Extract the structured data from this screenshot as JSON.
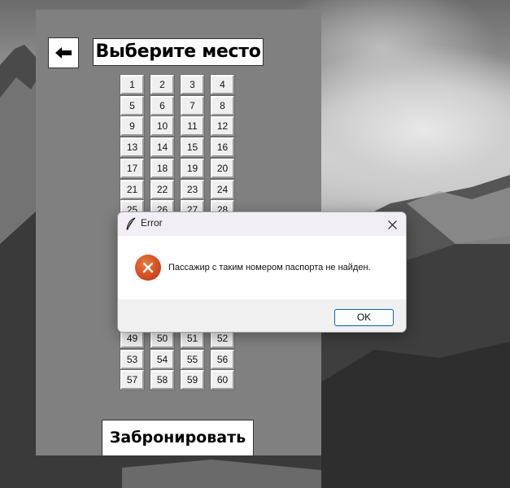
{
  "app": {
    "title": "Выберите место",
    "back_icon": "arrow-left-icon",
    "book_button": "Забронировать"
  },
  "seats_top": [
    "1",
    "2",
    "3",
    "4",
    "5",
    "6",
    "7",
    "8",
    "9",
    "10",
    "11",
    "12",
    "13",
    "14",
    "15",
    "16",
    "17",
    "18",
    "19",
    "20",
    "21",
    "22",
    "23",
    "24",
    "25",
    "26",
    "27",
    "28"
  ],
  "seats_bottom": [
    "49",
    "50",
    "51",
    "52",
    "53",
    "54",
    "55",
    "56",
    "57",
    "58",
    "59",
    "60"
  ],
  "dialog": {
    "title": "Error",
    "message": "Пассажир с таким номером паспорта не найден.",
    "ok_label": "OK",
    "app_icon": "feather-icon",
    "status_icon": "error-icon",
    "close_icon": "close-icon",
    "error_color": "#d9451c"
  }
}
